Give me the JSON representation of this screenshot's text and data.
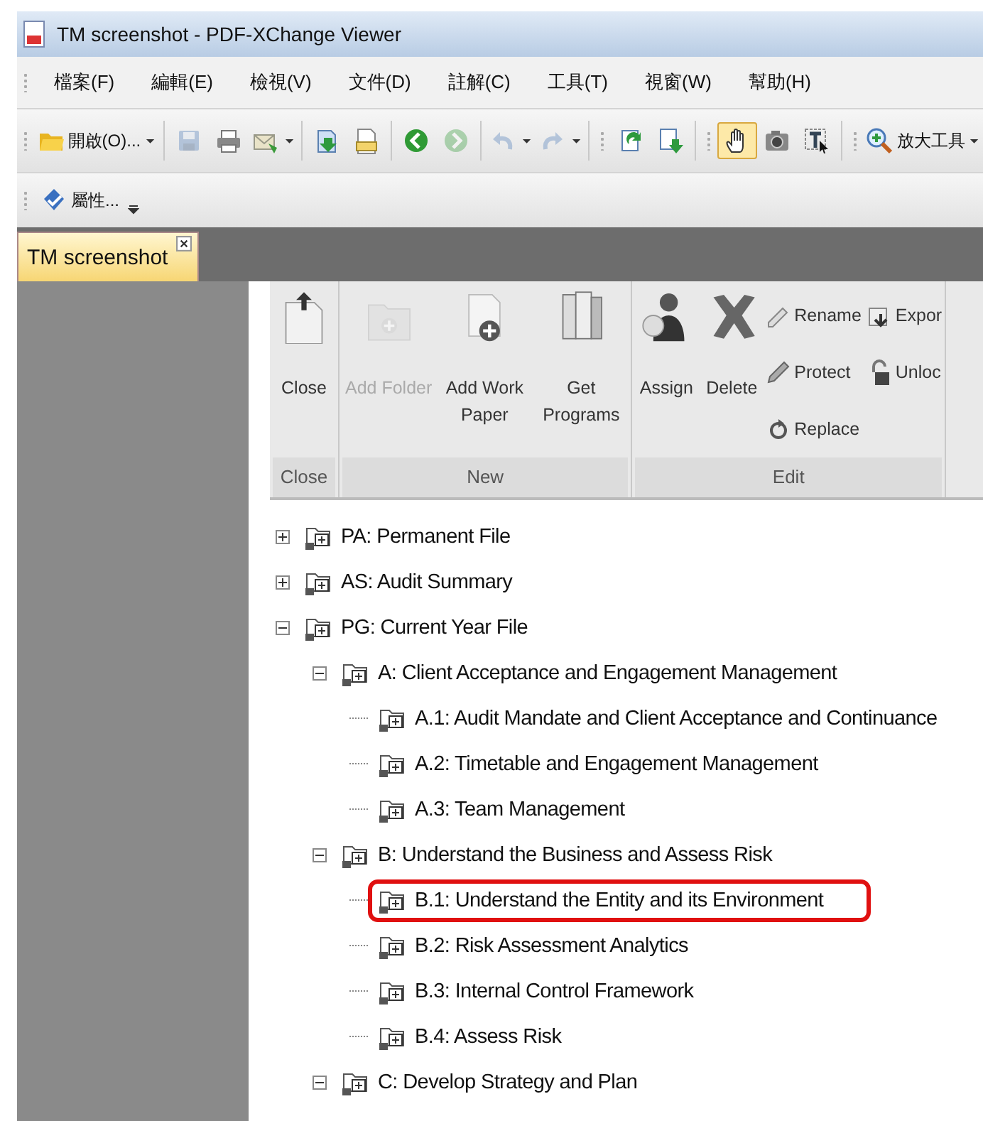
{
  "window": {
    "title": "TM screenshot - PDF-XChange Viewer"
  },
  "menu": [
    "檔案(F)",
    "編輯(E)",
    "檢視(V)",
    "文件(D)",
    "註解(C)",
    "工具(T)",
    "視窗(W)",
    "幫助(H)"
  ],
  "toolbar": [
    {
      "label": "開啟(O)...",
      "dropdown": true,
      "disabled": false,
      "selected": false
    },
    {
      "dropdown": false,
      "disabled": true,
      "selected": false
    },
    {
      "dropdown": false,
      "disabled": false,
      "selected": false
    },
    {
      "dropdown": true,
      "disabled": false,
      "selected": false
    },
    {
      "dropdown": false,
      "disabled": false,
      "selected": false
    },
    {
      "dropdown": false,
      "disabled": false,
      "selected": false
    },
    {
      "dropdown": false,
      "disabled": false,
      "selected": false
    },
    {
      "dropdown": false,
      "disabled": true,
      "selected": false
    },
    {
      "dropdown": true,
      "disabled": true,
      "selected": false
    },
    {
      "dropdown": true,
      "disabled": true,
      "selected": false
    },
    {
      "dropdown": false,
      "disabled": false,
      "selected": false
    },
    {
      "dropdown": false,
      "disabled": false,
      "selected": false
    },
    {
      "dropdown": false,
      "disabled": false,
      "selected": true
    },
    {
      "dropdown": false,
      "disabled": false,
      "selected": false
    },
    {
      "dropdown": false,
      "disabled": false,
      "selected": false
    },
    {
      "label": "放大工具",
      "dropdown": true,
      "disabled": false,
      "selected": false
    }
  ],
  "toolbar2": [
    {
      "label": "屬性..."
    }
  ],
  "tabs": [
    {
      "label": "TM screenshot",
      "selected": true
    }
  ],
  "ribbon": {
    "groups": [
      {
        "label": "Close",
        "large": [
          {
            "label": "Close",
            "disabled": false
          }
        ]
      },
      {
        "label": "New",
        "large": [
          {
            "label": "Add Folder",
            "disabled": true
          },
          {
            "label": "Add Work Paper",
            "disabled": false
          },
          {
            "label": "Get Programs",
            "disabled": false
          }
        ]
      },
      {
        "label": "Edit",
        "large": [
          {
            "label": "Assign",
            "disabled": false
          },
          {
            "label": "Delete",
            "disabled": false
          }
        ],
        "small": [
          {
            "label": "Rename"
          },
          {
            "label": "Protect"
          },
          {
            "label": "Replace"
          },
          {
            "label": "Expor"
          },
          {
            "label": "Unloc"
          }
        ]
      }
    ]
  },
  "tree": {
    "items": [
      {
        "label": "PA: Permanent File",
        "expanded": false,
        "highlighted": false
      },
      {
        "label": "AS: Audit Summary",
        "expanded": false,
        "highlighted": false
      },
      {
        "label": "PG: Current Year File",
        "expanded": true,
        "highlighted": false,
        "children": [
          {
            "label": "A: Client Acceptance and Engagement Management",
            "expanded": true,
            "highlighted": false,
            "children": [
              {
                "label": "A.1: Audit Mandate and Client Acceptance and Continuance",
                "highlighted": false
              },
              {
                "label": "A.2: Timetable and Engagement Management",
                "highlighted": false
              },
              {
                "label": "A.3: Team Management",
                "highlighted": false
              }
            ]
          },
          {
            "label": "B: Understand the Business and Assess Risk",
            "expanded": true,
            "highlighted": false,
            "children": [
              {
                "label": "B.1: Understand the Entity and its Environment",
                "highlighted": true
              },
              {
                "label": "B.2: Risk Assessment Analytics",
                "highlighted": false
              },
              {
                "label": "B.3: Internal Control Framework",
                "highlighted": false
              },
              {
                "label": "B.4: Assess Risk",
                "highlighted": false
              }
            ]
          },
          {
            "label": "C: Develop Strategy and Plan",
            "expanded": true,
            "highlighted": false
          }
        ]
      }
    ]
  }
}
